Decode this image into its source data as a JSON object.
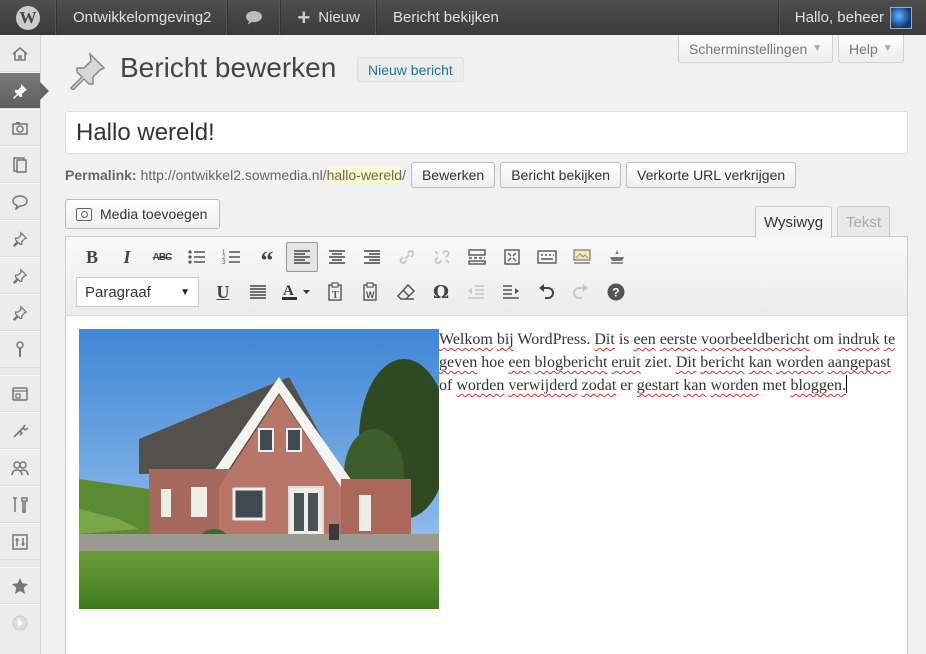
{
  "adminbar": {
    "site_name": "Ontwikkelomgeving2",
    "new_label": "Nieuw",
    "view_post_label": "Bericht bekijken",
    "greeting": "Hallo, beheer"
  },
  "sidemenu": {
    "icons": [
      "dashboard-icon",
      "posts-icon",
      "media-icon",
      "pages-icon",
      "comments-icon",
      "pin-icon",
      "pin-icon",
      "pin-icon",
      "tool-icon",
      "appearance-icon",
      "plugins-icon",
      "users-icon",
      "tools-icon",
      "settings-icon",
      "star-icon",
      "collapse-icon"
    ]
  },
  "screen_options_label": "Scherminstellingen",
  "help_label": "Help",
  "page_title": "Bericht bewerken",
  "new_post_label": "Nieuw bericht",
  "post_title": "Hallo wereld!",
  "permalink": {
    "label": "Permalink:",
    "base": "http://ontwikkel2.sowmedia.nl/",
    "slug": "hallo-wereld",
    "trail": "/",
    "edit_label": "Bewerken",
    "view_label": "Bericht bekijken",
    "shortlink_label": "Verkorte URL verkrijgen"
  },
  "media_button_label": "Media toevoegen",
  "tabs": {
    "visual": "Wysiwyg",
    "text": "Tekst"
  },
  "toolbar": {
    "bold": "B",
    "italic": "I",
    "strike": "ABC",
    "format_selected": "Paragraaf",
    "underline": "U",
    "special_chars": "Ω"
  },
  "content": {
    "w1": "Welkom",
    "w2": "bij",
    "w3": "WordPress.",
    "w4": "Dit",
    "w5": "is",
    "w6": "een",
    "w7": "eerste",
    "w8": "voorbeeldbericht",
    "w9": "om",
    "w10": "indruk",
    "w11": "te",
    "w12": "geven",
    "w13": "hoe",
    "w14": "een",
    "w15": "blogbericht",
    "w16": "eruit",
    "w17": "ziet.",
    "w18": "Dit",
    "w19": "bericht",
    "w20": "kan",
    "w21": "worden",
    "w22": "aangepast",
    "w23": "of",
    "w24": "worden",
    "w25": "verwijderd",
    "w26": "zodat",
    "w27": "er",
    "w28": "gestart",
    "w29": "kan",
    "w30": "worden",
    "w31": "met",
    "w32": "bloggen."
  },
  "colors": {
    "adminbar": "#464646",
    "link": "#21759b",
    "slug_highlight": "#fffbcc"
  }
}
